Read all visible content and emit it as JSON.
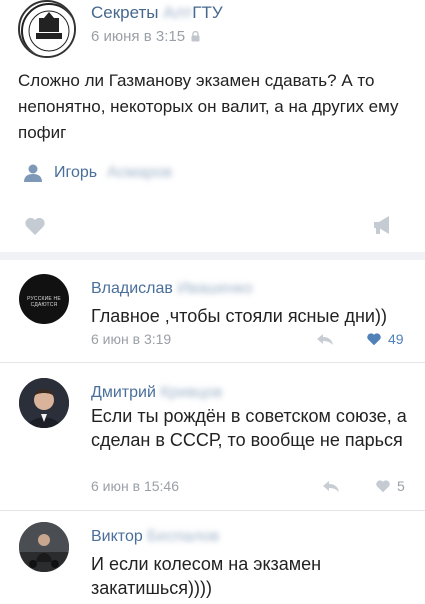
{
  "post": {
    "author_name": "Секреты ",
    "author_blur": "АлтГТУ",
    "author_suffix": "ГТУ",
    "time": "6 июня в 3:15",
    "text": "Сложно ли Газманову экзамен сдавать? А то непонятно, некоторых он валит, а на других ему пофиг",
    "signer_name": "Игорь",
    "signer_blur": "Асмаров",
    "icons": {
      "author": "person-icon",
      "like": "heart-icon",
      "share": "megaphone-icon",
      "time": "lock-icon"
    }
  },
  "comments": [
    {
      "name": "Владислав",
      "name_blur": "Ивашенко",
      "text": "Главное ,чтобы стояли ясные дни))",
      "time": "6 июн в 3:19",
      "likes": "49",
      "liked": true,
      "avatar_text": "РУССКИЕ НЕ СДАЮТСЯ",
      "avatar_color": "#111111"
    },
    {
      "name": "Дмитрий",
      "name_blur": "Кривцов",
      "text": "Если ты рождён в советском союзе, а сделан в СССР, то вообще не парься",
      "time": "6 июн в 15:46",
      "likes": "5",
      "liked": false,
      "avatar_color": "#2a2f3a"
    },
    {
      "name": "Виктор",
      "name_blur": "Беспалов",
      "text": "И если колесом на экзамен закатишься))))",
      "avatar_color": "#3b3d40"
    }
  ],
  "colors": {
    "link": "#4a6f9a",
    "liked": "#5181b8",
    "muted": "#9aa0a7"
  }
}
